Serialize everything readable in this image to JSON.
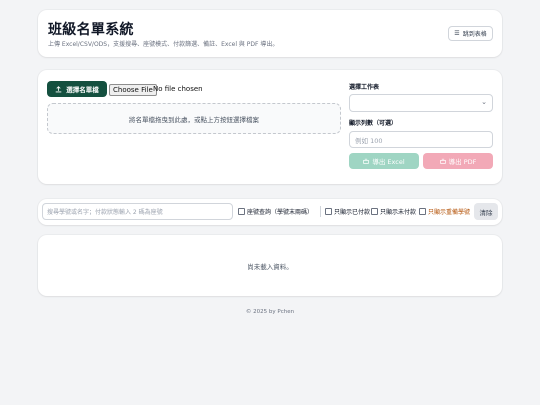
{
  "header": {
    "title": "班級名單系統",
    "subtitle": "上傳 Excel/CSV/ODS，支援搜尋、座號模式、付款篩選、備註、Excel 與 PDF 導出。",
    "jump_label": "跳到表格",
    "jump_icon": "list-icon"
  },
  "upload": {
    "pick_label": "選擇名單檔",
    "pick_icon": "upload-icon",
    "file_button": "Choose File",
    "file_status": "No file chosen",
    "dropzone_text": "將名單檔拖曳到此處，或點上方按鈕選擇檔案",
    "sheet_label": "選擇工作表",
    "sheet_value": "",
    "count_label": "顯示列數（可選）",
    "count_placeholder": "例如 100",
    "export_excel": "導出 Excel",
    "export_pdf": "導出 PDF",
    "excel_color": "#9fd5c3",
    "pdf_color": "#f2a9b7"
  },
  "filter": {
    "search_placeholder": "搜尋學號或名字；付款狀態輸入 2 碼為座號",
    "seat_mode": "座號查詢（學號末兩碼）",
    "paid_only": "只顯示已付款",
    "unpaid_only": "只顯示未付款",
    "remark_only": "只顯示重備學號",
    "clear_label": "清除"
  },
  "results": {
    "empty_text": "尚未載入資料。"
  },
  "footer": {
    "text": "© 2025 by Pchen"
  },
  "colors": {
    "primary": "#14503f",
    "background": "#f3f4f6",
    "warning_text": "#b45309"
  }
}
